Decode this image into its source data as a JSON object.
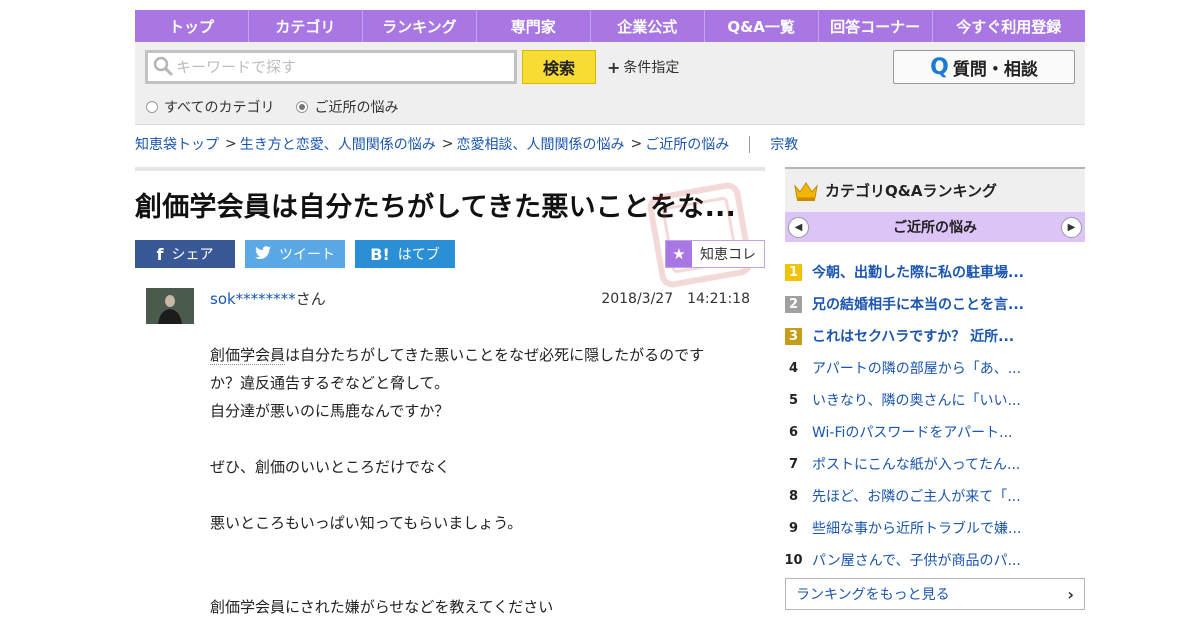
{
  "nav": {
    "items": [
      "トップ",
      "カテゴリ",
      "ランキング",
      "専門家",
      "企業公式",
      "Q&A一覧",
      "回答コーナー",
      "今すぐ利用登録"
    ]
  },
  "search": {
    "placeholder": "キーワードで探す",
    "button": "検索",
    "conditions": "条件指定",
    "ask_button": "質問・相談",
    "scope_all": "すべてのカテゴリ",
    "scope_current": "ご近所の悩み",
    "scope_selected": "ご近所の悩み"
  },
  "breadcrumb": {
    "items": [
      "知恵袋トップ",
      "生き方と恋愛、人間関係の悩み",
      "恋愛相談、人間関係の悩み",
      "ご近所の悩み"
    ],
    "tag": "宗教"
  },
  "question": {
    "title": "創価学会員は自分たちがしてきた悪いことをな...",
    "share": {
      "facebook": "シェア",
      "twitter": "ツイート",
      "hatena": "はてブ"
    },
    "chiecolle": "知恵コレ",
    "user": "sok********",
    "user_suffix": "さん",
    "timestamp": "2018/3/27　14:21:18",
    "body_dotted": "創価学会員",
    "body_line1_rest": "は自分たちがしてきた悪いことをなぜ必死に隠したがるのです",
    "body_line2": "か？違反通告するぞなどと脅して。",
    "body_line3": "自分達が悪いのに馬鹿なんですか？",
    "body_line4": "ぜひ、創価のいいところだけでなく",
    "body_line5": "悪いところもいっぱい知ってもらいましょう。",
    "body_line6": "創価学会員にされた嫌がらせなどを教えてください"
  },
  "ranking": {
    "title": "カテゴリQ&Aランキング",
    "category": "ご近所の悩み",
    "items": [
      {
        "rank": "1",
        "text": "今朝、出勤した際に私の駐車場..."
      },
      {
        "rank": "2",
        "text": "兄の結婚相手に本当のことを言..."
      },
      {
        "rank": "3",
        "text": "これはセクハラですか？ 近所..."
      },
      {
        "rank": "4",
        "text": "アパートの隣の部屋から「あ、..."
      },
      {
        "rank": "5",
        "text": "いきなり、隣の奥さんに「いい..."
      },
      {
        "rank": "6",
        "text": "Wi-Fiのパスワードをアパート..."
      },
      {
        "rank": "7",
        "text": "ポストにこんな紙が入ってたん..."
      },
      {
        "rank": "8",
        "text": "先ほど、お隣のご主人が来て「..."
      },
      {
        "rank": "9",
        "text": "些細な事から近所トラブルで嫌..."
      },
      {
        "rank": "10",
        "text": "パン屋さんで、子供が商品のパ..."
      }
    ],
    "more": "ランキングをもっと見る"
  }
}
